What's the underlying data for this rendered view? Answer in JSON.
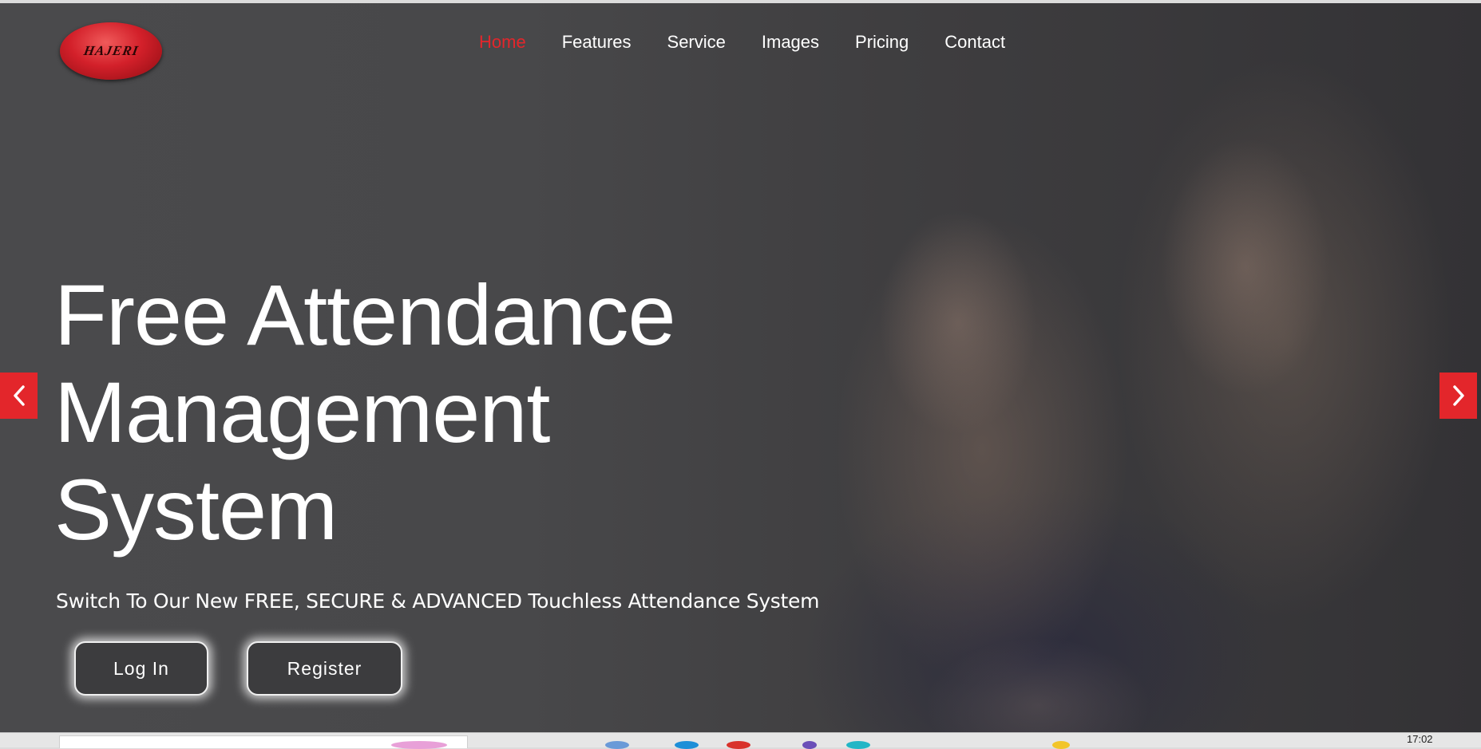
{
  "logo": {
    "text": "HAJERI"
  },
  "nav": {
    "items": [
      "Home",
      "Features",
      "Service",
      "Images",
      "Pricing",
      "Contact"
    ],
    "active": "Home"
  },
  "hero": {
    "headline_lines": [
      "Free Attendance",
      "Management",
      "System"
    ],
    "subtitle": "Switch To Our New FREE, SECURE & ADVANCED Touchless Attendance System",
    "login_label": "Log In",
    "register_label": "Register"
  },
  "carousel": {
    "prev_icon": "chevron-left-icon",
    "next_icon": "chevron-right-icon"
  },
  "taskbar": {
    "clock": "17:02"
  },
  "colors": {
    "accent": "#e3262b",
    "overlay": "#48484a",
    "text": "#ffffff"
  }
}
